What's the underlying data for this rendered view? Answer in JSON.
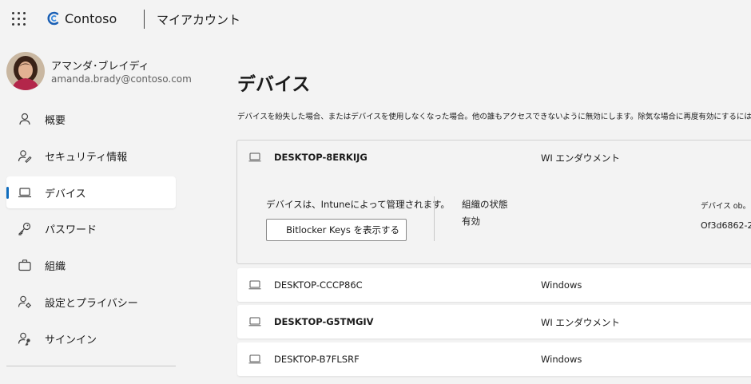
{
  "header": {
    "waffle_icon": "app-launcher-icon",
    "brand": "Contoso",
    "app_title": "マイアカウント"
  },
  "user": {
    "name": "アマンダ･ブレイディ",
    "email": "amanda.brady@contoso.com"
  },
  "sidebar": {
    "active_color": "#0f6cbd",
    "items": [
      {
        "label": "概要",
        "icon": "person-icon"
      },
      {
        "label": "セキュリティ情報",
        "icon": "security-info-icon"
      },
      {
        "label": "デバイス",
        "icon": "laptop-icon"
      },
      {
        "label": "パスワード",
        "icon": "key-icon"
      },
      {
        "label": "組織",
        "icon": "briefcase-icon"
      },
      {
        "label": "設定とプライバシー",
        "icon": "person-settings-icon"
      },
      {
        "label": "サインイン",
        "icon": "person-key-icon"
      }
    ]
  },
  "main": {
    "title": "デバイス",
    "description": "デバイスを紛失した場合、またはデバイスを使用しなくなった場合。他の誰もアクセスできないように無効にします。除気な場合に再度有効にするには",
    "devices": [
      {
        "name": "DESKTOP-8ERKIJG",
        "type": "WI エンダウメント",
        "expanded": true,
        "managed_text": "デバイスは、Intuneによって管理されます。",
        "bitlocker_button": "Bitlocker Keys を表示する",
        "org_state_label": "組織の状態",
        "org_state_value": "有効",
        "device_obj_label": "デバイス ob。",
        "device_obj_value": "Of3d6862-2"
      },
      {
        "name": "DESKTOP-CCCP86C",
        "type": "Windows"
      },
      {
        "name": "DESKTOP-G5TMGIV",
        "type": "WI エンダウメント"
      },
      {
        "name": "DESKTOP-B7FLSRF",
        "type": "Windows"
      }
    ]
  }
}
